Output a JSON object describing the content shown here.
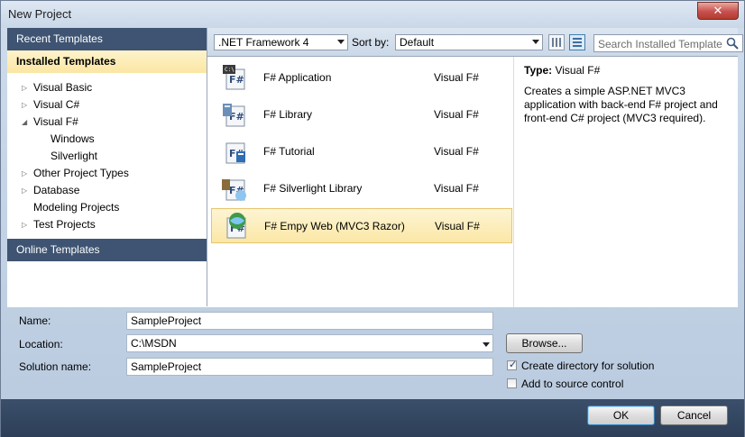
{
  "window": {
    "title": "New Project",
    "close_glyph": "✕"
  },
  "left_pane": {
    "recent_templates": "Recent Templates",
    "installed_templates": "Installed Templates",
    "online_templates": "Online Templates",
    "tree": [
      {
        "label": "Visual Basic",
        "level": 0,
        "arrow": "▷"
      },
      {
        "label": "Visual C#",
        "level": 0,
        "arrow": "▷"
      },
      {
        "label": "Visual F#",
        "level": 0,
        "arrow": "◢"
      },
      {
        "label": "Windows",
        "level": 1,
        "arrow": ""
      },
      {
        "label": "Silverlight",
        "level": 1,
        "arrow": ""
      },
      {
        "label": "Other Project Types",
        "level": 0,
        "arrow": "▷"
      },
      {
        "label": "Database",
        "level": 0,
        "arrow": "▷"
      },
      {
        "label": "Modeling Projects",
        "level": 0,
        "arrow": ""
      },
      {
        "label": "Test Projects",
        "level": 0,
        "arrow": "▷"
      }
    ]
  },
  "toolbar": {
    "framework": ".NET Framework 4",
    "sort_by_label": "Sort by:",
    "sort_by_value": "Default",
    "search_placeholder": "Search Installed Template"
  },
  "templates": [
    {
      "name": "F# Application",
      "language": "Visual F#",
      "icon": "fsharp-application-icon",
      "selected": false
    },
    {
      "name": "F# Library",
      "language": "Visual F#",
      "icon": "fsharp-library-icon",
      "selected": false
    },
    {
      "name": "F# Tutorial",
      "language": "Visual F#",
      "icon": "fsharp-tutorial-icon",
      "selected": false
    },
    {
      "name": "F# Silverlight Library",
      "language": "Visual F#",
      "icon": "fsharp-silverlight-library-icon",
      "selected": false
    },
    {
      "name": "F# Empy Web (MVC3 Razor)",
      "language": "Visual F#",
      "icon": "fsharp-web-icon",
      "selected": true
    }
  ],
  "info": {
    "type_label": "Type:",
    "type_value": "Visual F#",
    "description": "Creates a simple ASP.NET MVC3 application with back-end F# project and front-end C# project (MVC3  required)."
  },
  "form": {
    "name_label": "Name:",
    "name_value": "SampleProject",
    "location_label": "Location:",
    "location_value": "C:\\MSDN",
    "solution_name_label": "Solution name:",
    "solution_name_value": "SampleProject",
    "browse_label": "Browse...",
    "create_directory_label": "Create directory for solution",
    "create_directory_checked": true,
    "add_source_control_label": "Add to source control",
    "add_source_control_checked": false,
    "check_glyph": "✓"
  },
  "buttons": {
    "ok": "OK",
    "cancel": "Cancel"
  },
  "colors": {
    "header_bg": "#3e5472",
    "selection_bg": "#fbe7a6",
    "footer_bg": "#2d3f58",
    "accent": "#3c7fb1"
  }
}
